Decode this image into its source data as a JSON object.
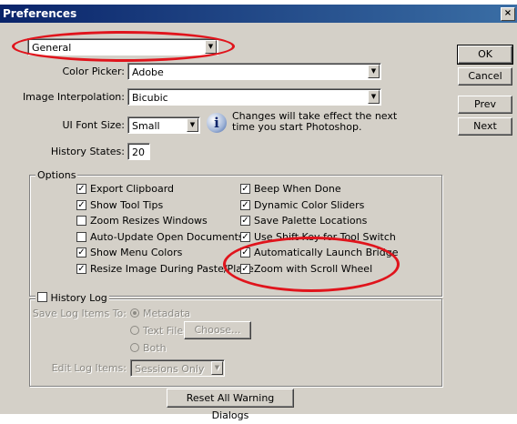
{
  "window": {
    "title": "Preferences",
    "close_glyph": "×"
  },
  "section_select": {
    "value": "General"
  },
  "color_picker": {
    "label": "Color Picker:",
    "value": "Adobe"
  },
  "image_interpolation": {
    "label": "Image Interpolation:",
    "value": "Bicubic"
  },
  "ui_font_size": {
    "label": "UI Font Size:",
    "value": "Small"
  },
  "font_note": {
    "line1": "Changes will take effect the next",
    "line2": "time you start Photoshop.",
    "icon": "info-icon"
  },
  "history_states": {
    "label": "History States:",
    "value": "20"
  },
  "options": {
    "title": "Options",
    "left": [
      {
        "label": "Export Clipboard",
        "checked": true
      },
      {
        "label": "Show Tool Tips",
        "checked": true
      },
      {
        "label": "Zoom Resizes Windows",
        "checked": false
      },
      {
        "label": "Auto-Update Open Documents",
        "checked": false
      },
      {
        "label": "Show Menu Colors",
        "checked": true
      },
      {
        "label": "Resize Image During Paste/Place",
        "checked": true
      }
    ],
    "right": [
      {
        "label": "Beep When Done",
        "checked": true
      },
      {
        "label": "Dynamic Color Sliders",
        "checked": true
      },
      {
        "label": "Save Palette Locations",
        "checked": true
      },
      {
        "label": "Use Shift Key for Tool Switch",
        "checked": true
      },
      {
        "label": "Automatically Launch Bridge",
        "checked": true
      },
      {
        "label": "Zoom with Scroll Wheel",
        "checked": true
      }
    ]
  },
  "history_log": {
    "title": "History Log",
    "checked": false,
    "save_to_label": "Save Log Items To:",
    "options": [
      "Metadata",
      "Text File",
      "Both"
    ],
    "choose_button": "Choose...",
    "edit_label": "Edit Log Items:",
    "edit_value": "Sessions Only"
  },
  "reset_button": "Reset All Warning Dialogs",
  "side_buttons": {
    "ok": "OK",
    "cancel": "Cancel",
    "prev": "Prev",
    "next": "Next"
  },
  "check_glyph": "✓",
  "colors": {
    "highlight_ring": "#e0141c",
    "title_bar": "#0a246a",
    "dialog_bg": "#d4d0c8"
  }
}
